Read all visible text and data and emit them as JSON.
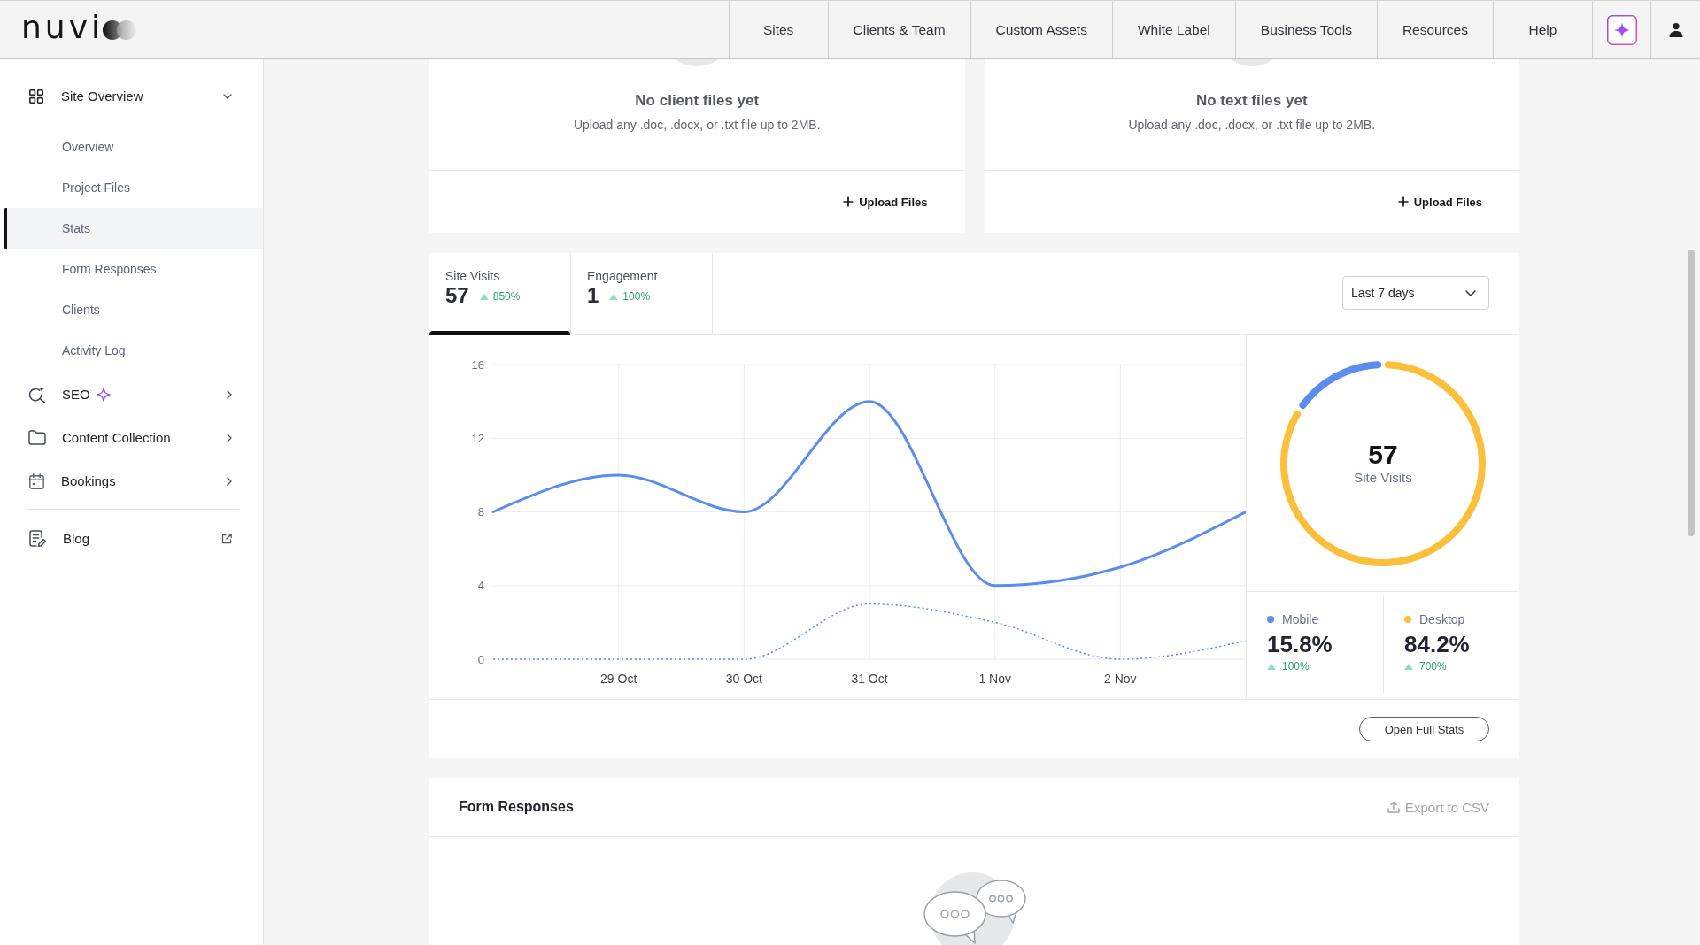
{
  "header": {
    "logo": "nuvi",
    "nav": [
      {
        "label": "Sites"
      },
      {
        "label": "Clients & Team"
      },
      {
        "label": "Custom Assets"
      },
      {
        "label": "White Label"
      },
      {
        "label": "Business Tools"
      },
      {
        "label": "Resources"
      },
      {
        "label": "Help"
      }
    ]
  },
  "sidebar": {
    "items": [
      {
        "label": "Site Overview",
        "expanded": true,
        "children": [
          {
            "label": "Overview",
            "selected": false
          },
          {
            "label": "Project Files",
            "selected": false
          },
          {
            "label": "Stats",
            "selected": true
          },
          {
            "label": "Form Responses",
            "selected": false
          },
          {
            "label": "Clients",
            "selected": false
          },
          {
            "label": "Activity Log",
            "selected": false
          }
        ]
      },
      {
        "label": "SEO",
        "expanded": false
      },
      {
        "label": "Content Collection",
        "expanded": false
      },
      {
        "label": "Bookings",
        "expanded": false
      }
    ],
    "links": [
      {
        "label": "Blog"
      }
    ]
  },
  "file_cards": [
    {
      "title": "No client files yet",
      "description": "Upload any .doc, .docx, or .txt file up to 2MB.",
      "action": "Upload Files"
    },
    {
      "title": "No text files yet",
      "description": "Upload any .doc, .docx, or .txt file up to 2MB.",
      "action": "Upload Files"
    }
  ],
  "stats": {
    "tabs": [
      {
        "label": "Site Visits",
        "value": "57",
        "change": "850%",
        "selected": true
      },
      {
        "label": "Engagement",
        "value": "1",
        "change": "100%",
        "selected": false
      }
    ],
    "date_range": {
      "value": "Last 7 days"
    },
    "chart_data": {
      "type": "line",
      "grid": true,
      "categories": [
        null,
        "29 Oct",
        "30 Oct",
        "31 Oct",
        "1 Nov",
        "2 Nov",
        null
      ],
      "ylim": [
        0,
        16
      ],
      "yticks": [
        0,
        4,
        8,
        12,
        16
      ],
      "series": [
        {
          "line_style": "solid",
          "values": [
            8,
            10,
            8,
            14,
            4,
            5,
            8
          ]
        },
        {
          "line_style": "dotted",
          "values": [
            0,
            0,
            0,
            3,
            2,
            0,
            1
          ]
        }
      ]
    },
    "devices": {
      "total": "57",
      "total_label": "Site Visits",
      "chart_data": {
        "type": "donut",
        "categories": [
          "Mobile",
          "Desktop"
        ],
        "values": [
          15.8,
          84.2
        ]
      },
      "legend": [
        {
          "color": "#5b8def",
          "share": "15.8%",
          "change": "100%"
        },
        {
          "color": "#fbbf3c",
          "share": "84.2%",
          "change": "700%"
        }
      ]
    },
    "action": "Open Full Stats"
  },
  "form_responses": {
    "title": "Form Responses",
    "export": {
      "label": "Export to CSV",
      "disabled": true
    }
  }
}
